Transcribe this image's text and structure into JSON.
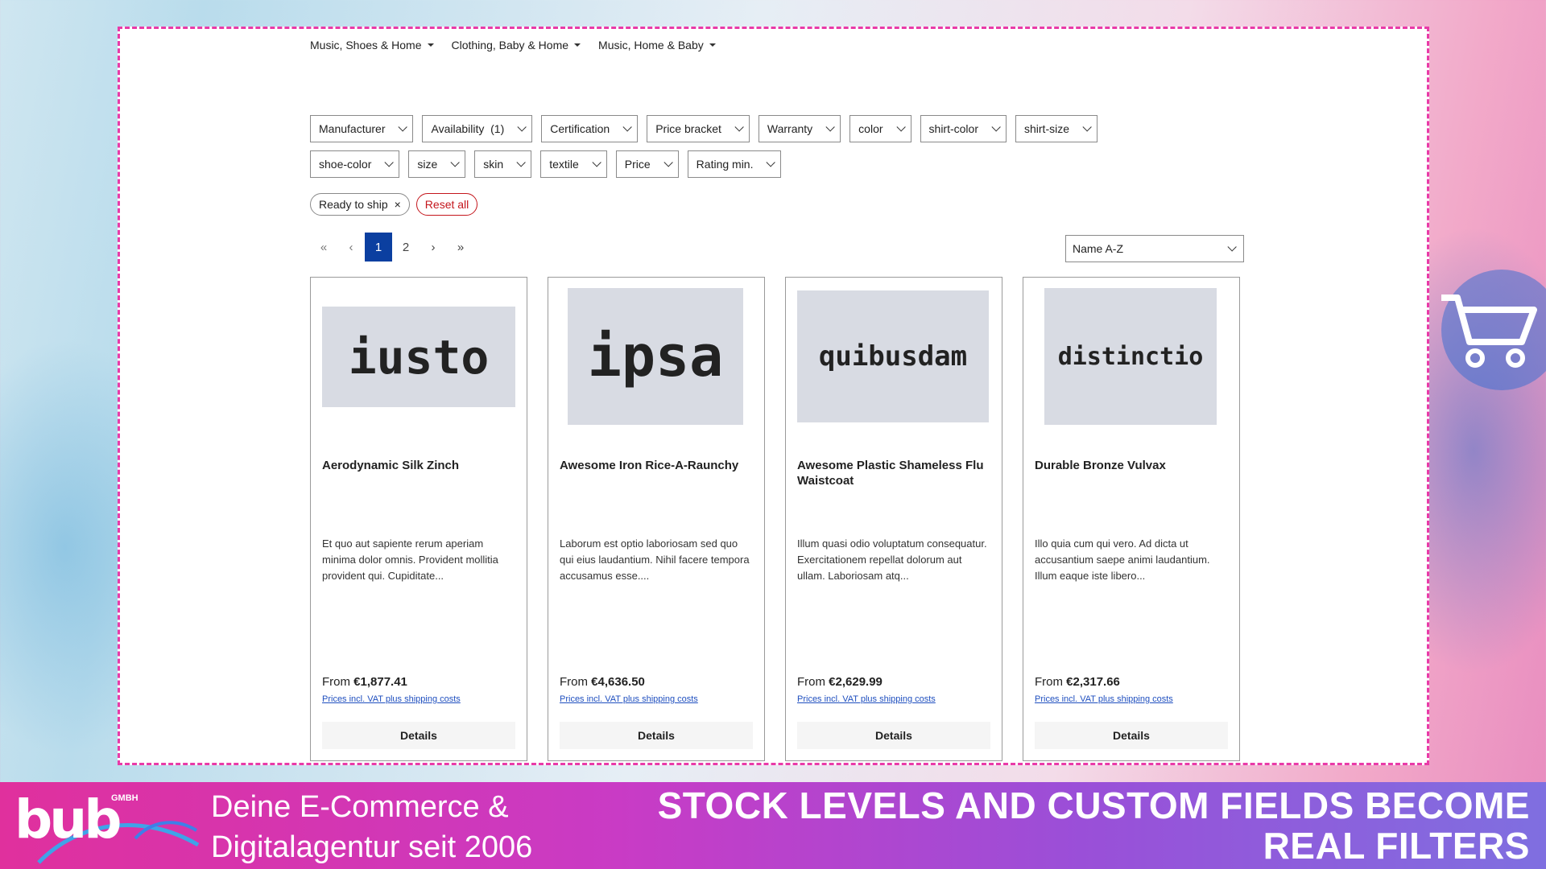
{
  "topnav": [
    {
      "label": "Music, Shoes & Home"
    },
    {
      "label": "Clothing, Baby & Home"
    },
    {
      "label": "Music, Home & Baby"
    }
  ],
  "filters": [
    {
      "label": "Manufacturer"
    },
    {
      "label": "Availability  (1)"
    },
    {
      "label": "Certification"
    },
    {
      "label": "Price bracket"
    },
    {
      "label": "Warranty"
    },
    {
      "label": "color"
    },
    {
      "label": "shirt-color"
    },
    {
      "label": "shirt-size"
    },
    {
      "label": "shoe-color"
    },
    {
      "label": "size"
    },
    {
      "label": "skin"
    },
    {
      "label": "textile"
    },
    {
      "label": "Price"
    },
    {
      "label": "Rating min."
    }
  ],
  "active_filters": {
    "chip_label": "Ready to ship",
    "chip_remove": "×",
    "reset_label": "Reset all"
  },
  "pagination": {
    "first": "«",
    "prev": "‹",
    "pages": [
      "1",
      "2"
    ],
    "active_page": "1",
    "next": "›",
    "last": "»"
  },
  "sort": {
    "selected": "Name A-Z"
  },
  "products": [
    {
      "image_text": "iusto",
      "name": "Aerodynamic Silk Zinch",
      "description": "Et quo aut sapiente rerum aperiam minima dolor omnis. Provident mollitia provident qui. Cupiditate...",
      "price_prefix": "From",
      "price": "€1,877.41",
      "vat_note": "Prices incl. VAT plus shipping costs",
      "details_label": "Details"
    },
    {
      "image_text": "ipsa",
      "name": "Awesome Iron Rice-A-Raunchy",
      "description": "Laborum est optio laboriosam sed quo qui eius laudantium. Nihil facere tempora accusamus esse....",
      "price_prefix": "From",
      "price": "€4,636.50",
      "vat_note": "Prices incl. VAT plus shipping costs",
      "details_label": "Details"
    },
    {
      "image_text": "quibusdam",
      "name": "Awesome Plastic Shameless Flu Waistcoat",
      "description": "Illum quasi odio voluptatum consequatur. Exercitationem repellat dolorum aut ullam. Laboriosam atq...",
      "price_prefix": "From",
      "price": "€2,629.99",
      "vat_note": "Prices incl. VAT plus shipping costs",
      "details_label": "Details"
    },
    {
      "image_text": "distinctio",
      "name": "Durable Bronze Vulvax",
      "description": "Illo quia cum qui vero. Ad dicta ut accusantium saepe animi laudantium. Illum eaque iste libero...",
      "price_prefix": "From",
      "price": "€2,317.66",
      "vat_note": "Prices incl. VAT plus shipping costs",
      "details_label": "Details"
    }
  ],
  "banner": {
    "logo_text": "bub",
    "logo_suffix": "GMBH",
    "tagline_line1": "Deine E-Commerce &",
    "tagline_line2": "Digitalagentur seit 2006",
    "headline_line1": "STOCK LEVELS AND CUSTOM FIELDS BECOME",
    "headline_line2": "REAL FILTERS"
  },
  "colors": {
    "frame_border": "#e93aa8",
    "active_page": "#0b3fa0",
    "reset_red": "#c4161c",
    "link_blue": "#1f4fbf",
    "image_placeholder": "#d8dbe3"
  },
  "icons": {
    "dropdown": "chevron-down-icon",
    "nav_caret": "caret-down-icon",
    "chip_close": "close-icon",
    "decor": "shopping-cart-icon"
  }
}
